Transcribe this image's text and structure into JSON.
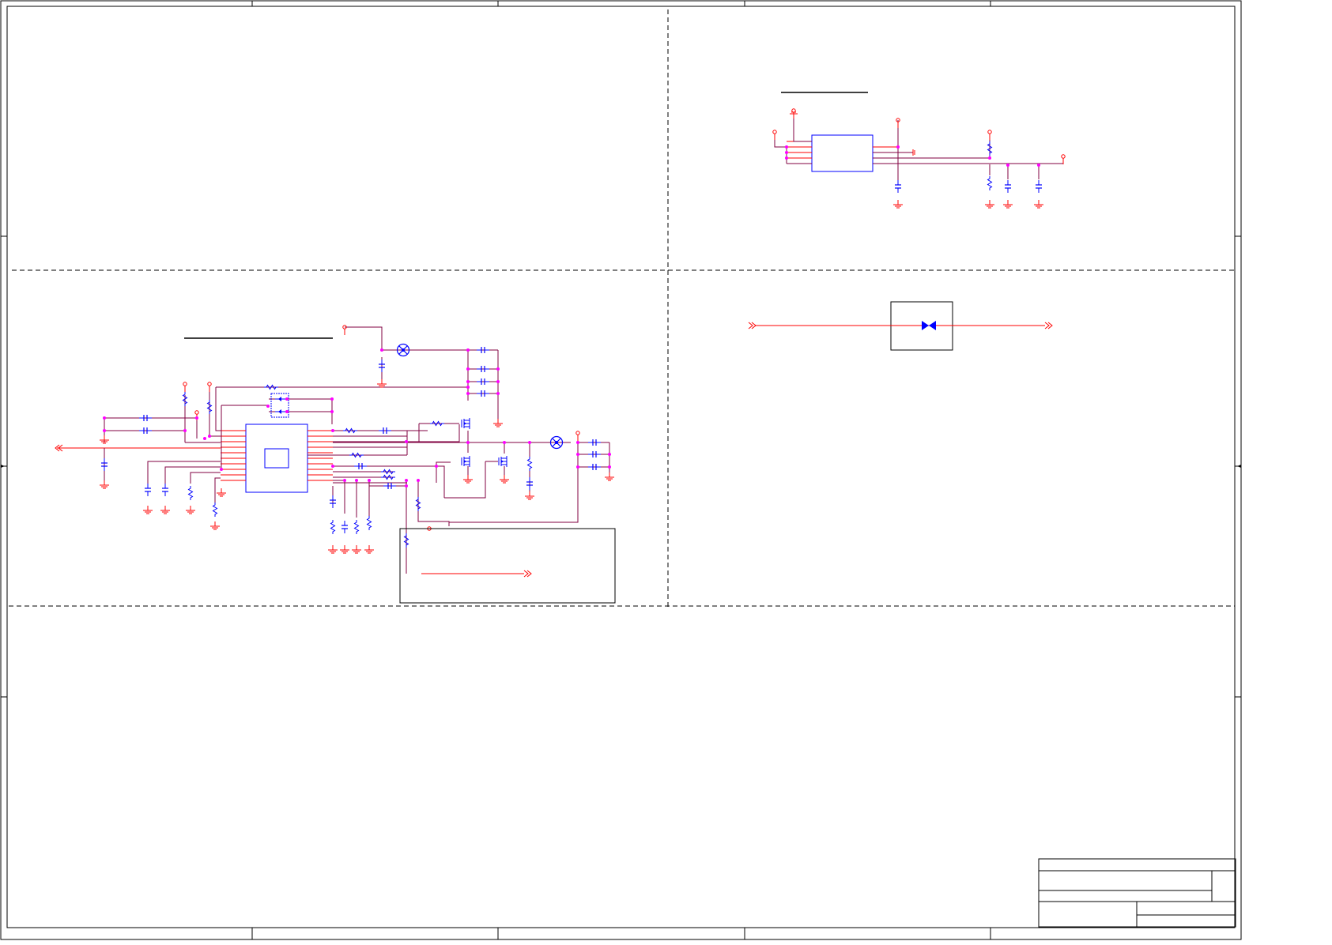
{
  "sheet": {
    "title_block": {},
    "column_zones": [],
    "row_zones": []
  },
  "sections": [
    {
      "id": "top-left"
    },
    {
      "id": "top-right",
      "title": ""
    },
    {
      "id": "middle-left",
      "title": ""
    },
    {
      "id": "middle-right"
    },
    {
      "id": "bottom"
    }
  ],
  "net_labels": [],
  "component_designators": [],
  "colors": {
    "border": "#000000",
    "wire": "#800040",
    "pin": "#ff0000",
    "junction": "#ff00ff",
    "component": "#0000ff",
    "power_symbol": "#ff0000",
    "section_divider": "#000000"
  },
  "icons": {
    "ic": "ic-body-icon",
    "resistor": "resistor-icon",
    "capacitor": "capacitor-icon",
    "ground": "ground-icon",
    "power": "power-port-icon",
    "mosfet": "mosfet-icon",
    "crystal": "crystal-icon",
    "connector": "off-sheet-connector-icon",
    "bidirectional": "bidirectional-tvs-icon"
  }
}
